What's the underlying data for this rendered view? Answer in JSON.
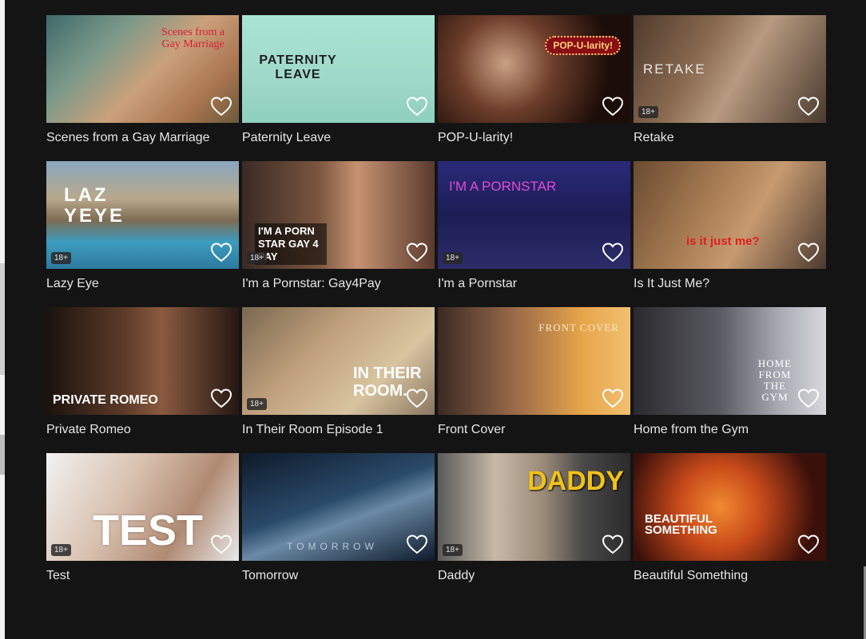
{
  "badge_label": "18+",
  "tiles": [
    {
      "title": "Scenes from a Gay Marriage",
      "overlay": "Scenes from a Gay Marriage",
      "badge": false
    },
    {
      "title": "Paternity Leave",
      "overlay": "PATERNITY LEAVE",
      "badge": false
    },
    {
      "title": "POP-U-larity!",
      "overlay": "POP-U-larity!",
      "badge": false
    },
    {
      "title": "Retake",
      "overlay": "RETAKE",
      "badge": true
    },
    {
      "title": "Lazy Eye",
      "overlay": "LAZ YEYE",
      "badge": true
    },
    {
      "title": "I'm a Pornstar: Gay4Pay",
      "overlay": "I'M A PORN STAR GAY 4 PAY",
      "badge": true
    },
    {
      "title": "I'm a Pornstar",
      "overlay": "I'M A PORNSTAR",
      "badge": true
    },
    {
      "title": "Is It Just Me?",
      "overlay": "is it just me?",
      "badge": false
    },
    {
      "title": "Private Romeo",
      "overlay": "PRIVATE ROMEO",
      "badge": false
    },
    {
      "title": "In Their Room Episode 1",
      "overlay": "IN THEIR ROOM.",
      "badge": true
    },
    {
      "title": "Front Cover",
      "overlay": "FRONT COVER",
      "badge": false
    },
    {
      "title": "Home from the Gym",
      "overlay": "HOME FROM THE GYM",
      "badge": false
    },
    {
      "title": "Test",
      "overlay": "TEST",
      "badge": true
    },
    {
      "title": "Tomorrow",
      "overlay": "TOMORROW",
      "badge": false
    },
    {
      "title": "Daddy",
      "overlay": "DADDY",
      "badge": true
    },
    {
      "title": "Beautiful Something",
      "overlay": "BEAUTIFUL SOMETHING",
      "badge": false
    }
  ],
  "colors": {
    "background": "#141414",
    "title_text": "#e6e6e6",
    "heart_stroke": "#ffffff"
  },
  "icons": {
    "favorite": "heart-outline-icon"
  }
}
